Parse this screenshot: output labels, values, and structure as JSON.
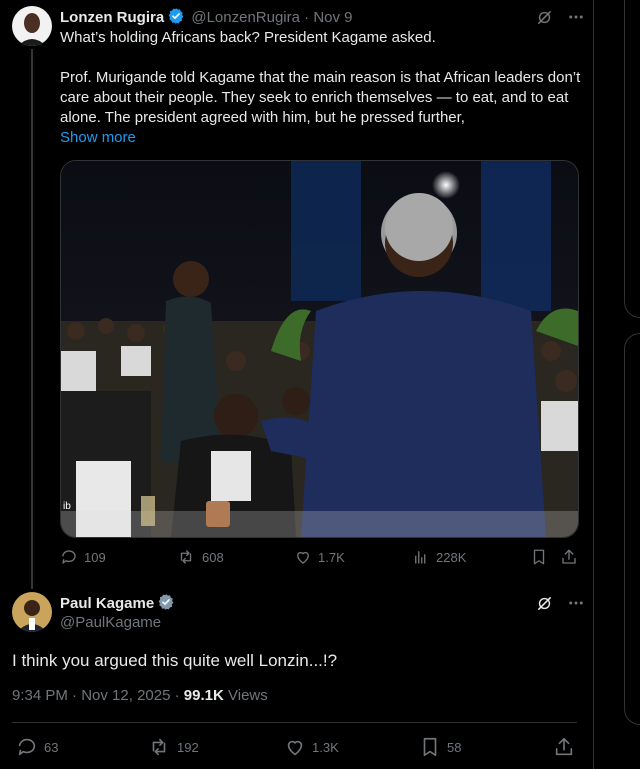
{
  "tweet1": {
    "name": "Lonzen Rugira",
    "handle": "@LonzenRugira",
    "separator": "·",
    "date": "Nov 9",
    "text_line1": "What’s holding Africans back? President Kagame asked.",
    "text_para2": "Prof. Murigande told Kagame that the main reason is that African leaders don’t care about their people. They seek to enrich themselves — to eat, and to eat alone. The president agreed with him, but he pressed further,",
    "show_more": "Show more",
    "replies": "109",
    "reposts": "608",
    "likes": "1.7K",
    "views": "228K"
  },
  "tweet2": {
    "name": "Paul Kagame",
    "handle": "@PaulKagame",
    "text": "I think you argued this quite well Lonzin...!?",
    "time": "9:34 PM",
    "separator": "·",
    "date": "Nov 12, 2025",
    "separator2": "·",
    "views_count": "99.1K",
    "views_label": "Views",
    "replies": "63",
    "reposts": "192",
    "likes": "1.3K",
    "bookmarks": "58"
  },
  "colors": {
    "background": "#000000",
    "text": "#e7e9ea",
    "muted": "#71767b",
    "link": "#1d9bf0",
    "border": "#2f3336",
    "verified": "#1d9bf0"
  }
}
